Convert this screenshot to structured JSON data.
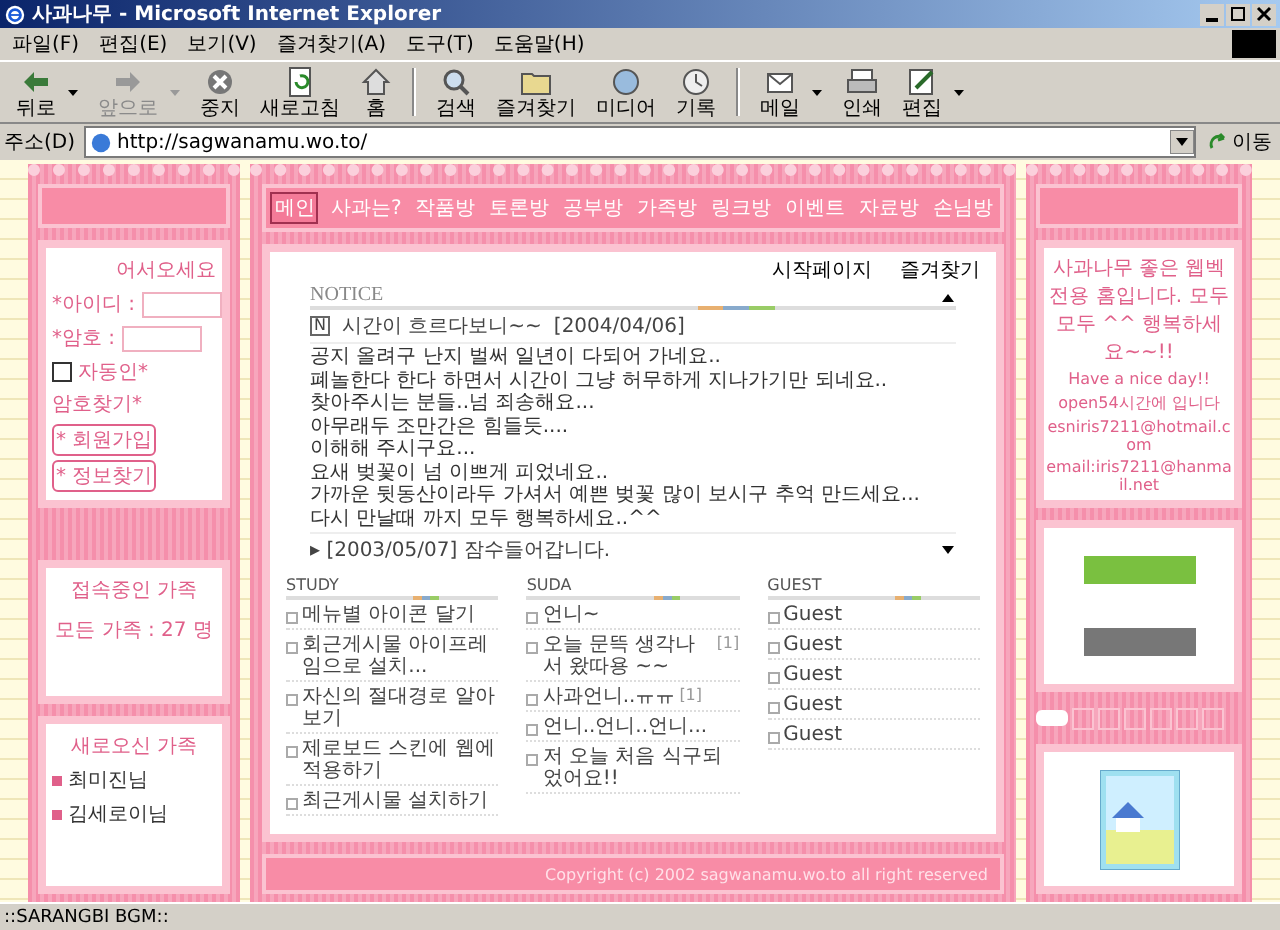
{
  "window": {
    "title": "사과나무 - Microsoft Internet Explorer"
  },
  "menu": [
    "파일(F)",
    "편집(E)",
    "보기(V)",
    "즐겨찾기(A)",
    "도구(T)",
    "도움말(H)"
  ],
  "toolbar": [
    {
      "label": "뒤로",
      "disabled": false
    },
    {
      "label": "앞으로",
      "disabled": true
    },
    {
      "label": "중지",
      "disabled": false
    },
    {
      "label": "새로고침",
      "disabled": false
    },
    {
      "label": "홈",
      "disabled": false
    },
    {
      "label": "검색",
      "disabled": false
    },
    {
      "label": "즐겨찾기",
      "disabled": false
    },
    {
      "label": "미디어",
      "disabled": false
    },
    {
      "label": "기록",
      "disabled": false
    },
    {
      "label": "메일",
      "disabled": false
    },
    {
      "label": "인쇄",
      "disabled": false
    },
    {
      "label": "편집",
      "disabled": false
    }
  ],
  "address": {
    "label": "주소(D)",
    "value": "http://sagwanamu.wo.to/",
    "go": "이동"
  },
  "login": {
    "greeting": "어서오세요",
    "id_label": "*아이디 :",
    "pw_label": "*암호 :",
    "auto_login": {
      "label": "자동인*",
      "checked": false
    },
    "find_pw": "암호찾기*",
    "buttons": [
      "* 회원가입",
      "* 정보찾기"
    ]
  },
  "online": {
    "title": "접속중인 가족",
    "count": "모든 가족 : 27 명"
  },
  "new_members": {
    "title": "새로오신 가족",
    "items": [
      "최미진님",
      "김세로이님"
    ]
  },
  "nav": [
    {
      "label": "메인",
      "selected": true
    },
    {
      "label": "사과는?",
      "selected": false
    },
    {
      "label": "작품방",
      "selected": false
    },
    {
      "label": "토론방",
      "selected": false
    },
    {
      "label": "공부방",
      "selected": false
    },
    {
      "label": "가족방",
      "selected": false
    },
    {
      "label": "링크방",
      "selected": false
    },
    {
      "label": "이벤트",
      "selected": false
    },
    {
      "label": "자료방",
      "selected": false
    },
    {
      "label": "손님방",
      "selected": false
    }
  ],
  "top_links": [
    "시작페이지",
    "즐겨찾기"
  ],
  "notice": {
    "title": "NOTICE",
    "badge": "N",
    "headline": "시간이 흐르다보니~~",
    "date": "[2004/04/06]",
    "lines": [
      "공지 올려구 난지 벌써 일년이 다되어 가네요..",
      "폐놀한다 한다 하면서 시간이 그냥 허무하게 지나가기만 되네요..",
      "찾아주시는 분들..넘 죄송해요...",
      "아무래두 조만간은 힘들듯....",
      "이해해 주시구요...",
      "요새 벚꽃이 넘 이쁘게 피었네요..",
      "가까운 뒷동산이라두 가셔서 예쁜 벚꽃 많이 보시구 추억 만드세요...",
      "다시 만날때 까지 모두 행복하세요..^^"
    ],
    "older": "▸ [2003/05/07]  잠수들어갑니다."
  },
  "boards": [
    {
      "title": "STUDY",
      "items": [
        {
          "text": "메뉴별 아이콘 달기"
        },
        {
          "text": "회근게시물 아이프레임으로 설치..."
        },
        {
          "text": "자신의 절대경로 알아보기"
        },
        {
          "text": "제로보드 스킨에 웹에 적용하기"
        },
        {
          "text": "최근게시물 설치하기"
        }
      ]
    },
    {
      "title": "SUDA",
      "items": [
        {
          "text": "언니~"
        },
        {
          "text": "오늘 문뜩 생각나서 왔따용 ~~",
          "count": "[1]"
        },
        {
          "text": "사과언니..ㅠㅠ",
          "count": "[1]"
        },
        {
          "text": "언니..언니..언니..."
        },
        {
          "text": "저 오늘 처음 식구되었어요!!"
        }
      ]
    },
    {
      "title": "GUEST",
      "items": [
        {
          "text": "Guest"
        },
        {
          "text": "Guest"
        },
        {
          "text": "Guest"
        },
        {
          "text": "Guest"
        },
        {
          "text": "Guest"
        }
      ]
    }
  ],
  "footer": "Copyright (c) 2002 sagwanamu.wo.to all right reserved",
  "info": [
    "사과나무 좋은 웹벡전용 홈입니다. 모두 모두 ^^ 행복하세요~~!!",
    "Have a nice day!!",
    "open54시간에 입니다",
    "esniris7211@hotmail.com",
    "email:iris7211@hanmail.net"
  ],
  "status_bar": "::SARANGBI BGM::"
}
